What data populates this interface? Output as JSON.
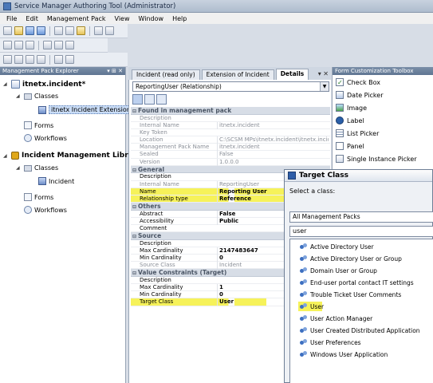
{
  "window": {
    "title": "Service Manager Authoring Tool (Administrator)"
  },
  "menu": [
    "File",
    "Edit",
    "Management Pack",
    "View",
    "Window",
    "Help"
  ],
  "explorer": {
    "title": "Management Pack Explorer",
    "pack1": {
      "name": "itnetx.incident*",
      "classes": "Classes",
      "class_item": "itnetx Incident Extension",
      "forms": "Forms",
      "workflows": "Workflows"
    },
    "pack2": {
      "name": "Incident Management Library",
      "classes": "Classes",
      "class_item": "Incident",
      "forms": "Forms",
      "workflows": "Workflows"
    }
  },
  "tabs": [
    "Incident (read only)",
    "Extension of Incident",
    "Details"
  ],
  "details": {
    "selector": "ReportingUser (Relationship)",
    "categories": {
      "found": "Found in management pack",
      "general": "General",
      "others": "Others",
      "source": "Source",
      "target": "Value Constraints (Target)"
    },
    "found_rows": [
      {
        "name": "Description",
        "value": ""
      },
      {
        "name": "Internal Name",
        "value": "itnetx.incident"
      },
      {
        "name": "Key Token",
        "value": ""
      },
      {
        "name": "Location",
        "value": "C:\\SCSM MPs\\itnetx.incident\\itnetx.incident.xml"
      },
      {
        "name": "Management Pack Name",
        "value": "itnetx.incident"
      },
      {
        "name": "Sealed",
        "value": "False"
      },
      {
        "name": "Version",
        "value": "1.0.0.0"
      }
    ],
    "general_rows": [
      {
        "name": "Description",
        "value": ""
      },
      {
        "name": "Internal Name",
        "value": "ReportingUser"
      },
      {
        "name": "Name",
        "value": "Reporting User"
      },
      {
        "name": "Relationship type",
        "value": "Reference"
      }
    ],
    "others_rows": [
      {
        "name": "Abstract",
        "value": "False"
      },
      {
        "name": "Accessibility",
        "value": "Public"
      },
      {
        "name": "Comment",
        "value": ""
      }
    ],
    "source_rows": [
      {
        "name": "Description",
        "value": ""
      },
      {
        "name": "Max Cardinality",
        "value": "2147483647"
      },
      {
        "name": "Min Cardinality",
        "value": "0"
      },
      {
        "name": "Source Class",
        "value": "Incident"
      }
    ],
    "target_rows": [
      {
        "name": "Description",
        "value": ""
      },
      {
        "name": "Max Cardinality",
        "value": "1"
      },
      {
        "name": "Min Cardinality",
        "value": "0"
      },
      {
        "name": "Target Class",
        "value": "User"
      }
    ]
  },
  "toolbox": {
    "title": "Form Customization Toolbox",
    "items": [
      "Check Box",
      "Date Picker",
      "Image",
      "Label",
      "List Picker",
      "Panel",
      "Single Instance Picker"
    ]
  },
  "dialog": {
    "title": "Target Class",
    "prompt": "Select a class:",
    "pack_filter": "All Management Packs",
    "search": "user",
    "classes": [
      "Active Directory User",
      "Active Directory User or Group",
      "Domain User or Group",
      "End-user portal contact IT settings",
      "Trouble Ticket User Comments",
      "User",
      "User Action Manager",
      "User Created Distributed Application",
      "User Preferences",
      "Windows User Application"
    ]
  },
  "colors": {
    "highlight": "#f6f25a",
    "panel_header": "#6a7f9b"
  }
}
